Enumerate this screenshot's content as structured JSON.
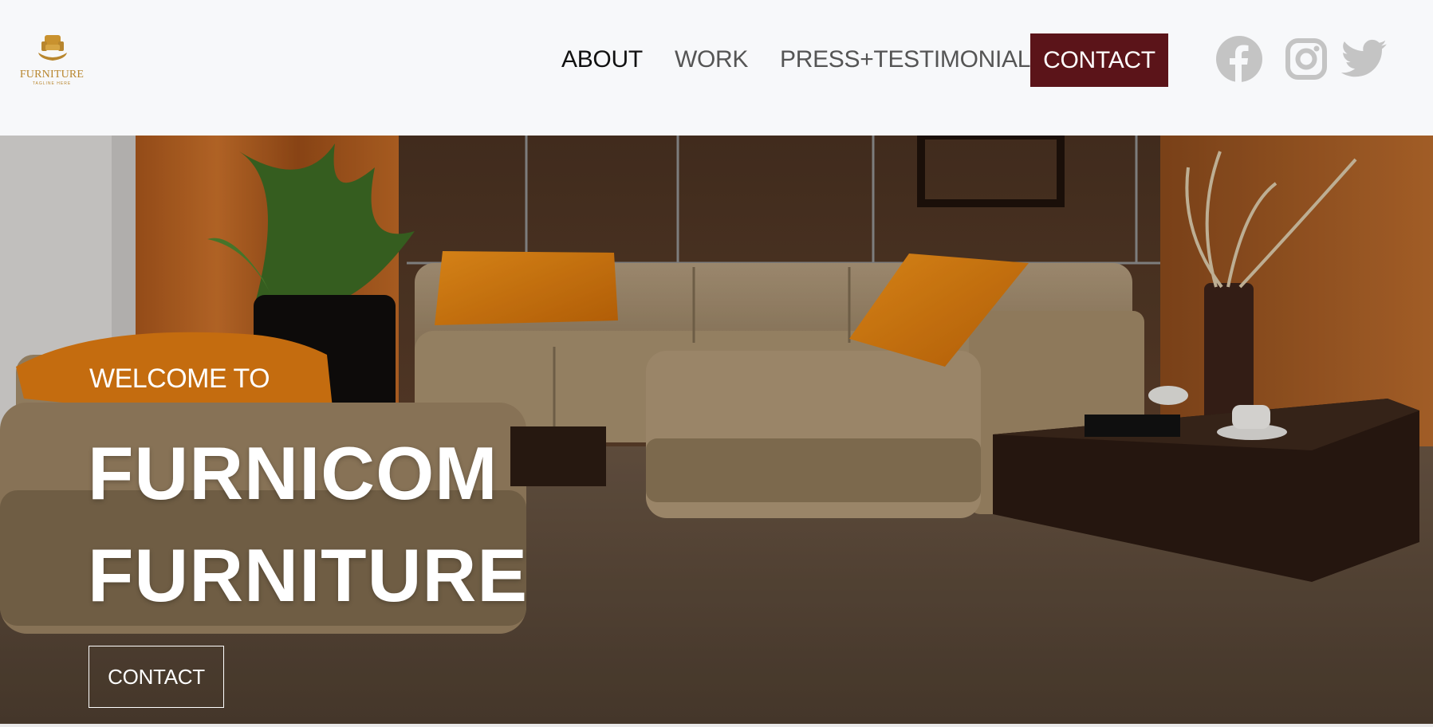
{
  "brand": {
    "logo_text": "FURNITURE",
    "tagline": "TAGLINE HERE",
    "logo_icon": "armchair-in-hand-icon",
    "logo_color": "#b8862e"
  },
  "nav": {
    "items": [
      {
        "label": "ABOUT",
        "active": true
      },
      {
        "label": "WORK",
        "active": false
      },
      {
        "label": "PRESS+TESTIMONIAL",
        "active": false
      }
    ],
    "contact_label": "CONTACT",
    "contact_color": "#5b1419"
  },
  "social": [
    {
      "icon": "facebook-icon"
    },
    {
      "icon": "instagram-icon"
    },
    {
      "icon": "twitter-icon"
    }
  ],
  "hero": {
    "eyebrow": "WELCOME TO",
    "title_line_1": "FURNICOM",
    "title_line_2": "FURNITURE",
    "cta_label": "CONTACT",
    "image": "living-room-sofa-photo"
  },
  "colors": {
    "header_bg": "#f7f8fa",
    "icon_gray": "#c4c4c4",
    "accent_orange": "#e8830d"
  }
}
